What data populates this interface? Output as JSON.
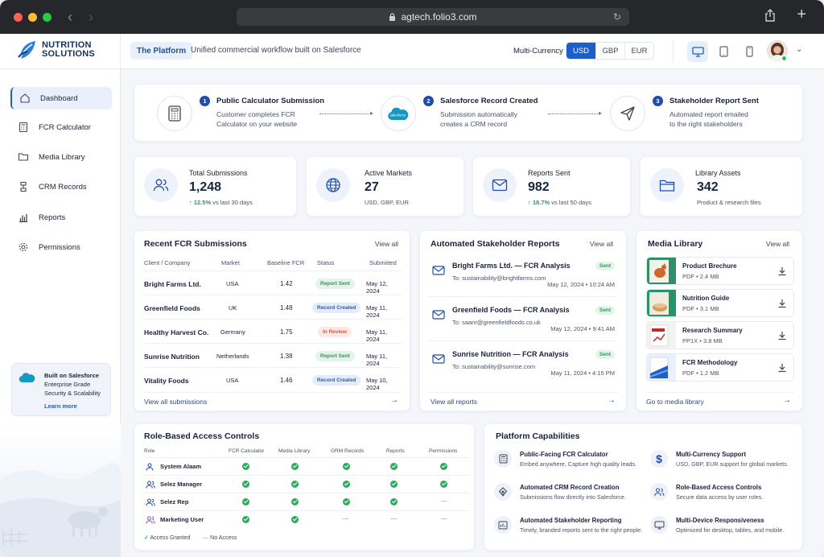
{
  "browser": {
    "url": "agtech.folio3.com"
  },
  "brand": {
    "line1": "NUTRITION",
    "line2": "SOLUTIONS"
  },
  "topbar": {
    "pill": "The Platform",
    "desc": "Unified commercial workflow built on Salesforce",
    "multi_currency_label": "Multi-Currency",
    "currencies": [
      "USD",
      "GBP",
      "EUR"
    ],
    "active_currency": "USD"
  },
  "sidebar": {
    "items": [
      {
        "label": "Dashboard",
        "icon": "home-icon"
      },
      {
        "label": "FCR Calculator",
        "icon": "calculator-icon"
      },
      {
        "label": "Media Library",
        "icon": "folder-icon"
      },
      {
        "label": "CRM Records",
        "icon": "network-icon"
      },
      {
        "label": "Reports",
        "icon": "bar-chart-icon"
      },
      {
        "label": "Permissions",
        "icon": "gear-icon"
      }
    ],
    "sf_card": {
      "title": "Built on Salesforce",
      "line2": "Enterprise Grade",
      "line3": "Security & Scalability",
      "link": "Learn more"
    }
  },
  "flow": [
    {
      "num": "1",
      "title": "Public Calculator Submission",
      "desc1": "Customer completes FCR",
      "desc2": "Calculator on your website"
    },
    {
      "num": "2",
      "title": "Salesforce Record Created",
      "desc1": "Submission automatically",
      "desc2": "creates a CRM record",
      "logo_text": "salesforce"
    },
    {
      "num": "3",
      "title": "Stakeholder Report Sent",
      "desc1": "Automated report emailed",
      "desc2": "to the right stakeholders"
    }
  ],
  "stats": [
    {
      "title": "Total Submissions",
      "value": "1,248",
      "change": "12.5%",
      "sub": "vs last 30 days"
    },
    {
      "title": "Active Markets",
      "value": "27",
      "sub": "USD, GBP, EUR"
    },
    {
      "title": "Reports Sent",
      "value": "982",
      "change": "18.7%",
      "sub": "vs last 50 days"
    },
    {
      "title": "Library Assets",
      "value": "342",
      "sub": "Product & research files"
    }
  ],
  "submissions": {
    "title": "Recent FCR Submissions",
    "view_all": "View all",
    "headers": [
      "Client / Company",
      "Market",
      "Baseline FCR",
      "Status",
      "Submitted"
    ],
    "rows": [
      {
        "client": "Bright Farms Ltd.",
        "market": "USA",
        "fcr": "1.42",
        "status": "Report Sent",
        "date": "May 12, 2024"
      },
      {
        "client": "Greenfield Foods",
        "market": "UK",
        "fcr": "1.48",
        "status": "Record Created",
        "date": "May 11, 2024"
      },
      {
        "client": "Healthy Harvest Co.",
        "market": "Germany",
        "fcr": "1.75",
        "status": "In Review",
        "date": "May 11, 2024"
      },
      {
        "client": "Sunrise Nutrition",
        "market": "Netherlands",
        "fcr": "1.38",
        "status": "Report Sent",
        "date": "May 11, 2024"
      },
      {
        "client": "Vitality Foods",
        "market": "USA",
        "fcr": "1.46",
        "status": "Record Created",
        "date": "May 10, 2024"
      }
    ],
    "footer": "View all submissions"
  },
  "reports": {
    "title": "Automated Stakeholder Reports",
    "view_all": "View all",
    "items": [
      {
        "title": "Bright Farms Ltd. — FCR Analysis",
        "to": "To: sustainability@brightfarms.com",
        "date": "May 12, 2024 • 10:24 AM",
        "status": "Sent"
      },
      {
        "title": "Greenfield Foods — FCR Analysis",
        "to": "To: saanr@greenfieldfoods.co.uk",
        "date": "May 12, 2024 • 9:41 AM",
        "status": "Sent"
      },
      {
        "title": "Sunrise Nutrition — FCR Analysis",
        "to": "To: sustainability@sunrise.com",
        "date": "May 11, 2024 • 4:15 PM",
        "status": "Sent"
      }
    ],
    "footer": "View all reports"
  },
  "media": {
    "title": "Media Library",
    "view_all": "View all",
    "items": [
      {
        "title": "Product Brechure",
        "meta": "PDF  •  2.4 MB"
      },
      {
        "title": "Nutrition Guide",
        "meta": "PDF  •  3.1 MB"
      },
      {
        "title": "Research Summary",
        "meta": "PP1X  •  3.8 MB"
      },
      {
        "title": "FCR Methodology",
        "meta": "PDF  •  1.2 MB"
      }
    ],
    "footer": "Go to media library"
  },
  "rbac": {
    "title": "Role-Based Access Controls",
    "headers": [
      "Role",
      "FCR Calculator",
      "Media Library",
      "GRM Records",
      "Reports",
      "Permissions"
    ],
    "rows": [
      {
        "role": "System Alaam",
        "access": [
          true,
          true,
          true,
          true,
          true
        ]
      },
      {
        "role": "Selez Manager",
        "access": [
          true,
          true,
          true,
          true,
          true
        ]
      },
      {
        "role": "Selez Rep",
        "access": [
          true,
          true,
          true,
          true,
          false
        ]
      },
      {
        "role": "Marketing User",
        "access": [
          true,
          true,
          false,
          false,
          false
        ]
      }
    ],
    "legend_granted": "Access Granted",
    "legend_none": "No Access",
    "dash": "—"
  },
  "capabilities": {
    "title": "Platform Capabilities",
    "items": [
      {
        "title": "Public-Facing FCR Calculator",
        "desc": "Embed anywhere, Capture high quality leads."
      },
      {
        "title": "Multi-Currency Support",
        "desc": "USD, GBP, EUR support for global markets."
      },
      {
        "title": "Automated CRM Record Creation",
        "desc": "Submissions flow directly into Salesforce."
      },
      {
        "title": "Role-Based Access Controls",
        "desc": "Secure data access by user roles."
      },
      {
        "title": "Automated Stakeholder Reporting",
        "desc": "Timely, branded reports sent to the right people."
      },
      {
        "title": "Multi-Device Responsiveness",
        "desc": "Optimized for desktop, tables, and mobile."
      }
    ]
  },
  "colors": {
    "accent": "#1e5fc7",
    "success": "#2eaa5f",
    "warn": "#d9572f"
  }
}
